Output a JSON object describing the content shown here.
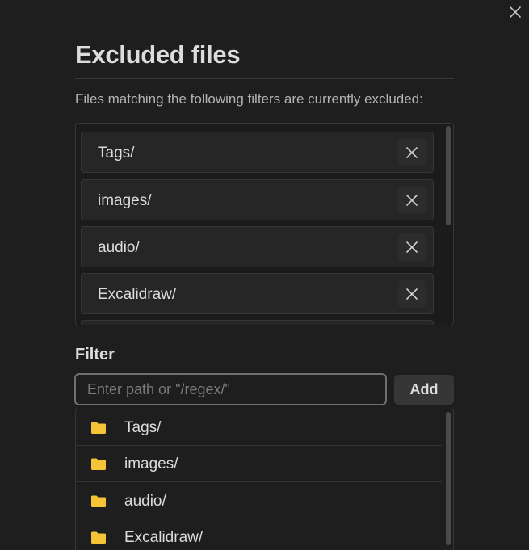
{
  "modal": {
    "title": "Excluded files",
    "description": "Files matching the following filters are currently excluded:"
  },
  "excluded": {
    "items": [
      {
        "label": "Tags/"
      },
      {
        "label": "images/"
      },
      {
        "label": "audio/"
      },
      {
        "label": "Excalidraw/"
      }
    ]
  },
  "filter": {
    "heading": "Filter",
    "placeholder": "Enter path or \"/regex/\"",
    "value": "",
    "add_label": "Add"
  },
  "suggestions": {
    "items": [
      {
        "label": "Tags/",
        "icon": "folder-icon"
      },
      {
        "label": "images/",
        "icon": "folder-icon"
      },
      {
        "label": "audio/",
        "icon": "folder-icon"
      },
      {
        "label": "Excalidraw/",
        "icon": "folder-icon"
      }
    ]
  },
  "colors": {
    "background": "#1e1e1e",
    "folder": "#f5c437",
    "border": "#363636"
  },
  "icons": {
    "close": "close-icon",
    "remove": "x-icon",
    "folder": "folder-icon"
  }
}
